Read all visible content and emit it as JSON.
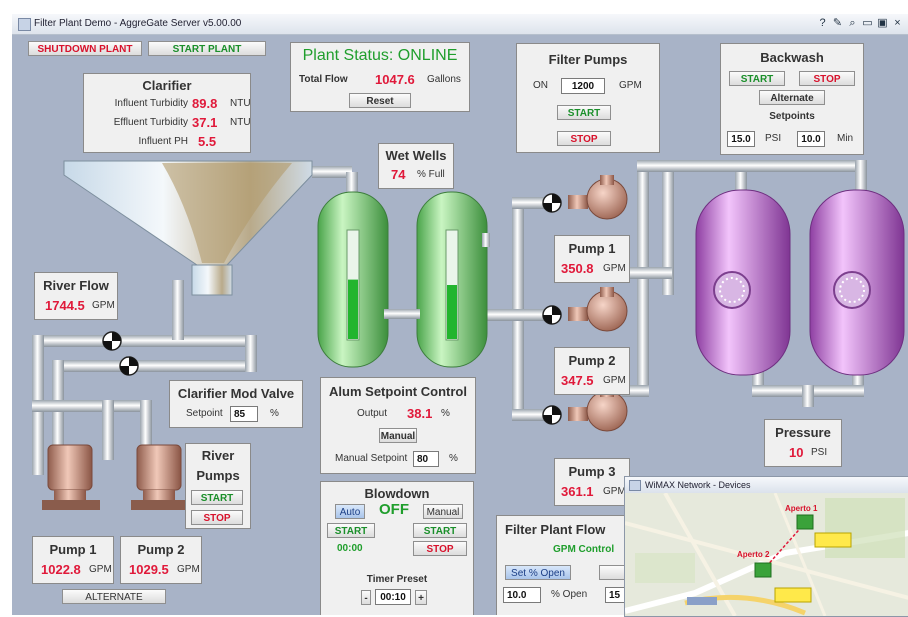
{
  "window": {
    "title": "Filter Plant Demo - AggreGate Server v5.00.00",
    "controls": [
      "?",
      "✎",
      "⌕",
      "▭",
      "▣",
      "×"
    ]
  },
  "toolbar": {
    "shutdown_label": "SHUTDOWN PLANT",
    "start_label": "START PLANT"
  },
  "status": {
    "title_prefix": "Plant Status:",
    "title_value": "ONLINE",
    "flow_label": "Total Flow",
    "flow_value": "1047.6",
    "flow_unit": "Gallons",
    "reset_label": "Reset"
  },
  "clarifier": {
    "title": "Clarifier",
    "rows": [
      {
        "label": "Influent Turbidity",
        "value": "89.8",
        "unit": "NTU"
      },
      {
        "label": "Effluent Turbidity",
        "value": "37.1",
        "unit": "NTU"
      },
      {
        "label": "Influent PH",
        "value": "5.5",
        "unit": ""
      }
    ]
  },
  "filter_pumps": {
    "title": "Filter Pumps",
    "on_label": "ON",
    "value": "1200",
    "unit": "GPM",
    "start_label": "START",
    "stop_label": "STOP"
  },
  "backwash": {
    "title": "Backwash",
    "start_label": "START",
    "stop_label": "STOP",
    "alternate_label": "Alternate",
    "setpoints_label": "Setpoints",
    "psi_value": "15.0",
    "psi_unit": "PSI",
    "min_value": "10.0",
    "min_unit": "Min"
  },
  "wet_wells": {
    "title": "Wet Wells",
    "value": "74",
    "unit": "% Full",
    "level_left": 0.55,
    "level_right": 0.5
  },
  "river_flow": {
    "title": "River Flow",
    "value": "1744.5",
    "unit": "GPM"
  },
  "clarifier_valve": {
    "title": "Clarifier Mod Valve",
    "setpoint_label": "Setpoint",
    "setpoint_value": "85",
    "unit": "%"
  },
  "alum": {
    "title": "Alum Setpoint Control",
    "output_label": "Output",
    "output_value": "38.1",
    "output_unit": "%",
    "manual_label": "Manual",
    "manual_setpoint_label": "Manual Setpoint",
    "manual_setpoint_value": "80",
    "manual_unit": "%"
  },
  "blowdown": {
    "title": "Blowdown",
    "auto_label": "Auto",
    "state": "OFF",
    "manual_label": "Manual",
    "start_left": "START",
    "time": "00:00",
    "start_right": "START",
    "stop_label": "STOP",
    "timer_label": "Timer Preset",
    "timer_value": "00:10"
  },
  "pumps": [
    {
      "title": "Pump 1",
      "value": "350.8",
      "unit": "GPM"
    },
    {
      "title": "Pump 2",
      "value": "347.5",
      "unit": "GPM"
    },
    {
      "title": "Pump 3",
      "value": "361.1",
      "unit": "GPM"
    }
  ],
  "pressure": {
    "title": "Pressure",
    "value": "10",
    "unit": "PSI"
  },
  "river_pumps": {
    "title_line1": "River",
    "title_line2": "Pumps",
    "start_label": "START",
    "stop_label": "STOP"
  },
  "bottom_pumps": [
    {
      "title": "Pump 1",
      "value": "1022.8",
      "unit": "GPM"
    },
    {
      "title": "Pump 2",
      "value": "1029.5",
      "unit": "GPM"
    }
  ],
  "alternate_label": "ALTERNATE",
  "filter_flow": {
    "title": "Filter Plant Flow",
    "sub": "GPM Control",
    "set_open_label": "Set % Open",
    "value": "10.0",
    "unit": "% Open",
    "value2": "15"
  },
  "map_window": {
    "title": "WiMAX Network - Devices",
    "device1_label": "Aperto 1",
    "device2_label": "Aperto 2"
  },
  "colors": {
    "canvas": "#a8b3c7",
    "value_red": "#e0193a",
    "ok_green": "#1f9e2c",
    "tank_green": "#7fd07a",
    "tank_purple": "#c070d0",
    "pump_copper": "#c98a74"
  }
}
